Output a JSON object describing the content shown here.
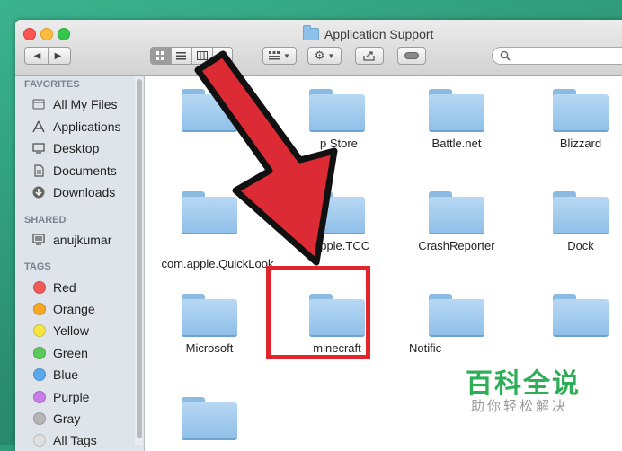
{
  "window": {
    "title": "Application Support"
  },
  "colors": {
    "accent_red": "#e0262c",
    "folder_blue": "#90c0e8",
    "watermark_green": "#2fae5a"
  },
  "toolbar": {
    "nav_back": "◀",
    "nav_forward": "▶",
    "arrange_icon": "arrange-icon",
    "action_icon": "gear-icon",
    "share_icon": "share-icon",
    "tags_icon": "tag-icon",
    "search_icon": "search-icon"
  },
  "sidebar": {
    "favorites_header": "FAVORITES",
    "favorites": [
      {
        "label": "All My Files",
        "icon": "all-files-icon"
      },
      {
        "label": "Applications",
        "icon": "applications-icon"
      },
      {
        "label": "Desktop",
        "icon": "desktop-icon"
      },
      {
        "label": "Documents",
        "icon": "documents-icon"
      },
      {
        "label": "Downloads",
        "icon": "downloads-icon"
      }
    ],
    "shared_header": "SHARED",
    "shared": [
      {
        "label": "anujkumar",
        "icon": "computer-icon"
      }
    ],
    "tags_header": "TAGS",
    "tags": [
      {
        "label": "Red",
        "color": "#f05b57"
      },
      {
        "label": "Orange",
        "color": "#f5a623"
      },
      {
        "label": "Yellow",
        "color": "#f4e542"
      },
      {
        "label": "Green",
        "color": "#5ac85a"
      },
      {
        "label": "Blue",
        "color": "#5aa9ea"
      },
      {
        "label": "Purple",
        "color": "#c77ce8"
      },
      {
        "label": "Gray",
        "color": "#b5b5b5"
      },
      {
        "label": "All Tags",
        "color": "#e0e0e0"
      }
    ]
  },
  "folders": [
    {
      "label": ""
    },
    {
      "label": "p Store"
    },
    {
      "label": "Battle.net"
    },
    {
      "label": "Blizzard"
    },
    {
      "label": ""
    },
    {
      "label": "com.apple.QuickLook"
    },
    {
      "label": "c...pple.TCC"
    },
    {
      "label": "CrashReporter"
    },
    {
      "label": "Dock"
    },
    {
      "label": "Microsoft"
    },
    {
      "label": "minecraft"
    },
    {
      "label": "Notific"
    },
    {
      "label": ""
    },
    {
      "label": ""
    }
  ],
  "watermark": {
    "title": "百科全说",
    "subtitle": "助你轻松解决"
  }
}
